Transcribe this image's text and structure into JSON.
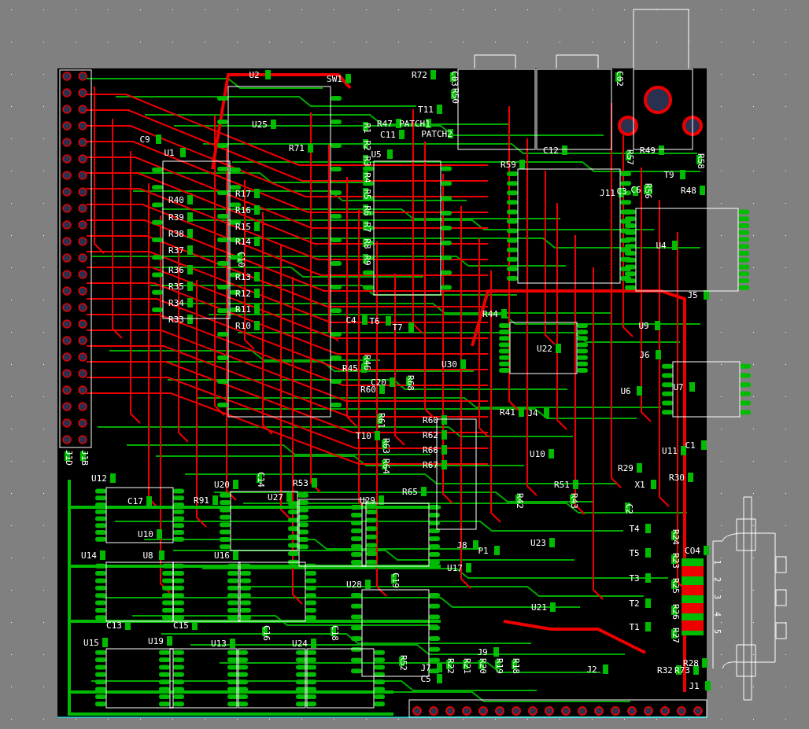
{
  "board": {
    "labels": [
      "U2",
      "SW1",
      "U25",
      "C9",
      "U1",
      "R71",
      "R40",
      "R39",
      "R38",
      "R37",
      "R36",
      "R35",
      "R34",
      "R33",
      "R17",
      "R16",
      "R15",
      "R14",
      "C10",
      "R13",
      "R12",
      "R11",
      "R10",
      "R1",
      "R2",
      "R3",
      "R4",
      "R5",
      "R6",
      "R7",
      "R8",
      "R9",
      "U5",
      "R47",
      "PATCH1",
      "PATCH2",
      "C11",
      "T11",
      "R72",
      "C03",
      "R50",
      "C4",
      "T6",
      "T7",
      "R45",
      "R46",
      "C20",
      "R60",
      "R68",
      "U30",
      "R44",
      "U22",
      "C12",
      "R59",
      "C3",
      "C6",
      "J11",
      "R56",
      "R57",
      "R49",
      "T9",
      "R58",
      "R48",
      "C02",
      "U4",
      "J5",
      "U9",
      "J6",
      "U6",
      "U7",
      "U11",
      "C1",
      "R29",
      "R30",
      "X1",
      "C2",
      "T4",
      "T5",
      "T3",
      "T2",
      "T1",
      "R24",
      "R23",
      "R25",
      "R26",
      "R27",
      "CO4",
      "R28",
      "R32",
      "R73",
      "J1",
      "J2",
      "J9",
      "R21",
      "R20",
      "R19",
      "R18",
      "R22",
      "J7",
      "C5",
      "R52",
      "R41",
      "J4",
      "U10",
      "R51",
      "R42",
      "R43",
      "U23",
      "P1",
      "J8",
      "U21",
      "U17",
      "R61",
      "T10",
      "R63",
      "R64",
      "R60",
      "R62",
      "R66",
      "R67",
      "R65",
      "U20",
      "C14",
      "R53",
      "U27",
      "R91",
      "U12",
      "C17",
      "U10",
      "U14",
      "U8",
      "U16",
      "U29",
      "U28",
      "C19",
      "U15",
      "U19",
      "U13",
      "U24",
      "C13",
      "C15",
      "C16",
      "C18",
      "J1B",
      "J1D"
    ]
  },
  "connector": {
    "pins": [
      "1",
      "2",
      "3",
      "4",
      "5"
    ]
  }
}
